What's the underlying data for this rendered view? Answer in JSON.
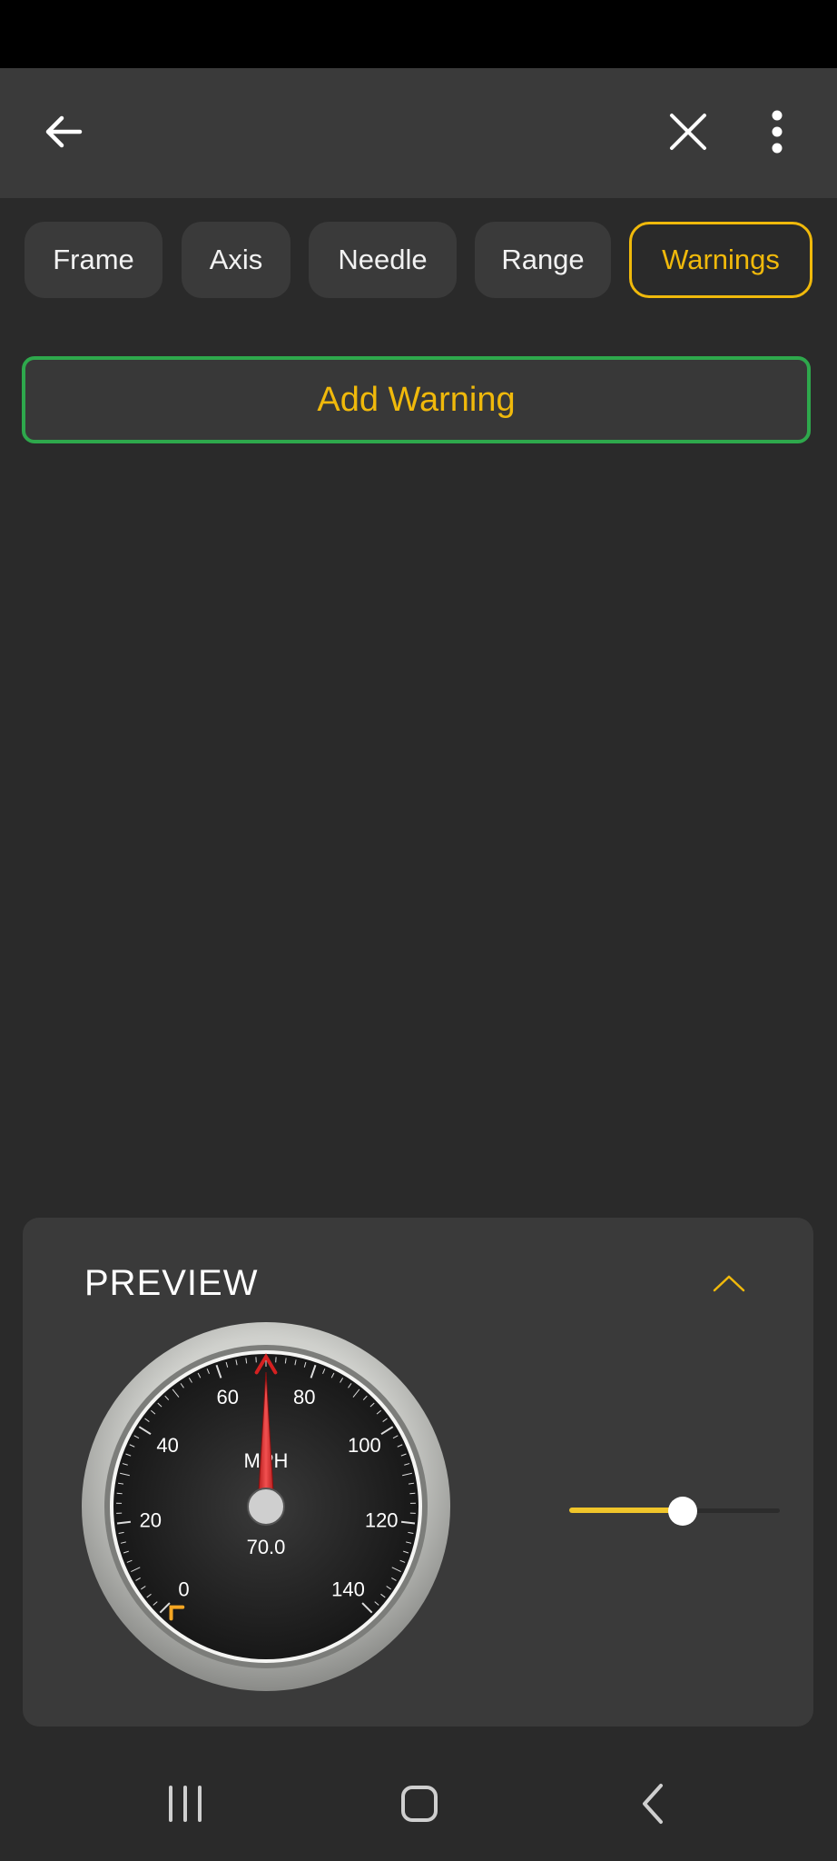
{
  "tabs": [
    {
      "label": "Frame"
    },
    {
      "label": "Axis"
    },
    {
      "label": "Needle"
    },
    {
      "label": "Range"
    },
    {
      "label": "Warnings"
    }
  ],
  "active_tab": "Warnings",
  "add_warning_label": "Add Warning",
  "preview": {
    "title": "PREVIEW",
    "gauge": {
      "unit": "MPH",
      "value_text": "70.0",
      "value": 70,
      "min": 0,
      "max": 140,
      "tick_labels": [
        "0",
        "20",
        "40",
        "60",
        "80",
        "100",
        "120",
        "140"
      ],
      "needle_color": "#d42020",
      "warning_marker_color": "#f5a623"
    },
    "slider": {
      "value_fraction": 0.54,
      "accent_color": "#f0c52a"
    }
  },
  "colors": {
    "accent": "#f0b90b",
    "success_border": "#2ea84c",
    "surface": "#3a3a3a",
    "background": "#2a2a2a"
  },
  "icons": {
    "back": "arrow-left-icon",
    "close": "close-icon",
    "more": "more-vertical-icon",
    "collapse": "chevron-up-icon",
    "nav_recents": "recents-icon",
    "nav_home": "home-icon",
    "nav_back": "back-chevron-icon"
  }
}
